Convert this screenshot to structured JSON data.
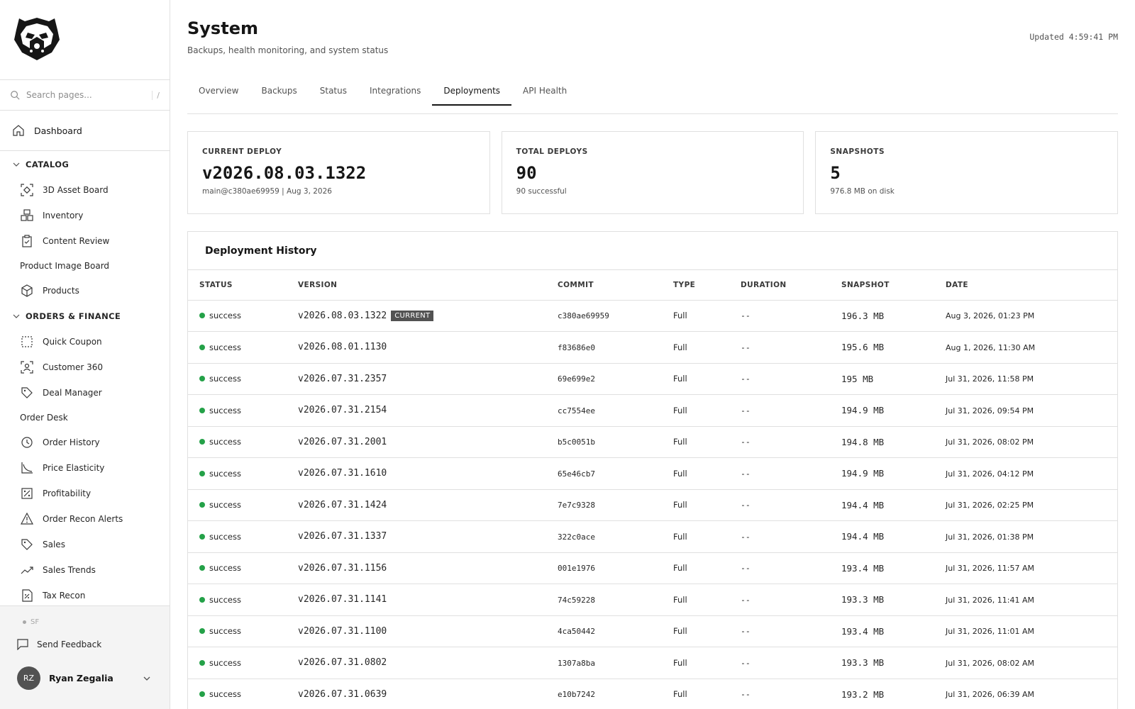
{
  "sidebar": {
    "search_placeholder": "Search pages...",
    "search_shortcut": "/",
    "dashboard_label": "Dashboard",
    "sections": [
      {
        "title": "CATALOG",
        "items": [
          {
            "label": "3D Asset Board",
            "icon": "scan-icon"
          },
          {
            "label": "Inventory",
            "icon": "boxes-icon"
          },
          {
            "label": "Content Review",
            "icon": "clipboard-check-icon"
          }
        ]
      },
      {
        "title": "ORDERS & FINANCE",
        "items": []
      }
    ],
    "product_image_board": "Product Image Board",
    "products": "Products",
    "quick_coupon": "Quick Coupon",
    "customer_360": "Customer 360",
    "deal_manager": "Deal Manager",
    "order_desk": "Order Desk",
    "order_history": "Order History",
    "price_elasticity": "Price Elasticity",
    "profitability": "Profitability",
    "order_recon_alerts": "Order Recon Alerts",
    "sales": "Sales",
    "sales_trends": "Sales Trends",
    "tax_recon": "Tax Recon",
    "env": "SF",
    "feedback": "Send Feedback",
    "user_initials": "RZ",
    "user_name": "Ryan Zegalia"
  },
  "header": {
    "title": "System",
    "subtitle": "Backups, health monitoring, and system status",
    "updated": "Updated 4:59:41 PM"
  },
  "tabs": [
    "Overview",
    "Backups",
    "Status",
    "Integrations",
    "Deployments",
    "API Health"
  ],
  "active_tab": "Deployments",
  "cards": {
    "current": {
      "label": "CURRENT DEPLOY",
      "value": "v2026.08.03.1322",
      "sub": "main@c380ae69959 | Aug 3, 2026"
    },
    "total": {
      "label": "TOTAL DEPLOYS",
      "value": "90",
      "sub": "90 successful"
    },
    "snapshots": {
      "label": "SNAPSHOTS",
      "value": "5",
      "sub": "976.8 MB on disk"
    }
  },
  "history": {
    "title": "Deployment History",
    "columns": [
      "STATUS",
      "VERSION",
      "COMMIT",
      "TYPE",
      "DURATION",
      "SNAPSHOT",
      "DATE"
    ],
    "current_badge": "CURRENT",
    "rows": [
      {
        "status": "success",
        "version": "v2026.08.03.1322",
        "commit": "c380ae69959",
        "type": "Full",
        "duration": "--",
        "snapshot": "196.3 MB",
        "date": "Aug 3, 2026, 01:23 PM",
        "current": true
      },
      {
        "status": "success",
        "version": "v2026.08.01.1130",
        "commit": "f83686e0",
        "type": "Full",
        "duration": "--",
        "snapshot": "195.6 MB",
        "date": "Aug 1, 2026, 11:30 AM"
      },
      {
        "status": "success",
        "version": "v2026.07.31.2357",
        "commit": "69e699e2",
        "type": "Full",
        "duration": "--",
        "snapshot": "195 MB",
        "date": "Jul 31, 2026, 11:58 PM"
      },
      {
        "status": "success",
        "version": "v2026.07.31.2154",
        "commit": "cc7554ee",
        "type": "Full",
        "duration": "--",
        "snapshot": "194.9 MB",
        "date": "Jul 31, 2026, 09:54 PM"
      },
      {
        "status": "success",
        "version": "v2026.07.31.2001",
        "commit": "b5c0051b",
        "type": "Full",
        "duration": "--",
        "snapshot": "194.8 MB",
        "date": "Jul 31, 2026, 08:02 PM"
      },
      {
        "status": "success",
        "version": "v2026.07.31.1610",
        "commit": "65e46cb7",
        "type": "Full",
        "duration": "--",
        "snapshot": "194.9 MB",
        "date": "Jul 31, 2026, 04:12 PM"
      },
      {
        "status": "success",
        "version": "v2026.07.31.1424",
        "commit": "7e7c9328",
        "type": "Full",
        "duration": "--",
        "snapshot": "194.4 MB",
        "date": "Jul 31, 2026, 02:25 PM"
      },
      {
        "status": "success",
        "version": "v2026.07.31.1337",
        "commit": "322c0ace",
        "type": "Full",
        "duration": "--",
        "snapshot": "194.4 MB",
        "date": "Jul 31, 2026, 01:38 PM"
      },
      {
        "status": "success",
        "version": "v2026.07.31.1156",
        "commit": "001e1976",
        "type": "Full",
        "duration": "--",
        "snapshot": "193.4 MB",
        "date": "Jul 31, 2026, 11:57 AM"
      },
      {
        "status": "success",
        "version": "v2026.07.31.1141",
        "commit": "74c59228",
        "type": "Full",
        "duration": "--",
        "snapshot": "193.3 MB",
        "date": "Jul 31, 2026, 11:41 AM"
      },
      {
        "status": "success",
        "version": "v2026.07.31.1100",
        "commit": "4ca50442",
        "type": "Full",
        "duration": "--",
        "snapshot": "193.4 MB",
        "date": "Jul 31, 2026, 11:01 AM"
      },
      {
        "status": "success",
        "version": "v2026.07.31.0802",
        "commit": "1307a8ba",
        "type": "Full",
        "duration": "--",
        "snapshot": "193.3 MB",
        "date": "Jul 31, 2026, 08:02 AM"
      },
      {
        "status": "success",
        "version": "v2026.07.31.0639",
        "commit": "e10b7242",
        "type": "Full",
        "duration": "--",
        "snapshot": "193.2 MB",
        "date": "Jul 31, 2026, 06:39 AM"
      }
    ]
  },
  "colors": {
    "success": "#24a148",
    "badge": "#525252",
    "border": "#e0e0e0"
  }
}
